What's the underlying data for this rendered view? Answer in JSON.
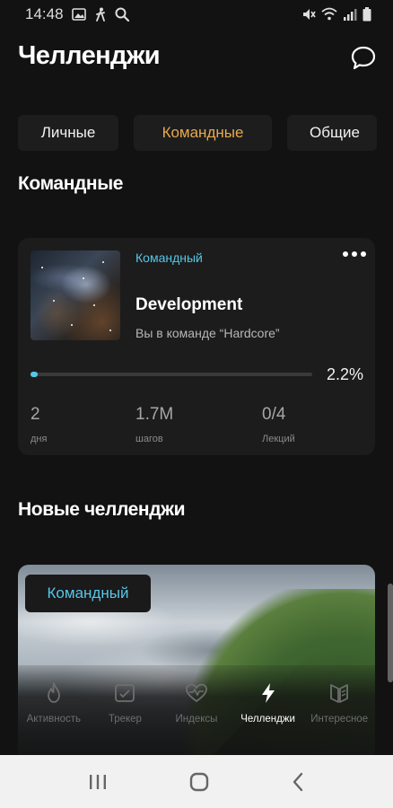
{
  "status_bar": {
    "time": "14:48",
    "left_icons": [
      "image-icon",
      "walk-icon",
      "search-icon"
    ],
    "right_icons": [
      "mute-icon",
      "wifi-icon",
      "signal-icon",
      "battery-icon"
    ]
  },
  "header": {
    "title": "Челленджи",
    "action_icon": "chat-bubble-icon"
  },
  "tabs": [
    {
      "label": "Личные",
      "active": false
    },
    {
      "label": "Командные",
      "active": true
    },
    {
      "label": "Общие",
      "active": false
    }
  ],
  "section_team": {
    "title": "Командные"
  },
  "team_card": {
    "badge": "Командный",
    "title": "Development",
    "subtitle": "Вы в команде “Hardcore”",
    "progress": 0.022,
    "progress_label": "2.2%",
    "stats": [
      {
        "value": "2",
        "label": "дня"
      },
      {
        "value": "1.7M",
        "label": "шагов"
      },
      {
        "value": "0/4",
        "label": "Лекций"
      }
    ]
  },
  "section_new": {
    "title": "Новые челленджи"
  },
  "new_card": {
    "badge": "Командный"
  },
  "bottom_nav": [
    {
      "label": "Активность",
      "icon": "flame-icon",
      "active": false
    },
    {
      "label": "Трекер",
      "icon": "tracker-icon",
      "active": false
    },
    {
      "label": "Индексы",
      "icon": "heart-pulse-icon",
      "active": false
    },
    {
      "label": "Челленджи",
      "icon": "lightning-icon",
      "active": true
    },
    {
      "label": "Интересное",
      "icon": "book-icon",
      "active": false
    }
  ],
  "system_nav": [
    "recents-icon",
    "home-icon",
    "back-icon"
  ],
  "colors": {
    "background": "#121212",
    "card": "#1c1c1c",
    "accent_cyan": "#56c7e8",
    "accent_orange": "#e9a94b"
  }
}
